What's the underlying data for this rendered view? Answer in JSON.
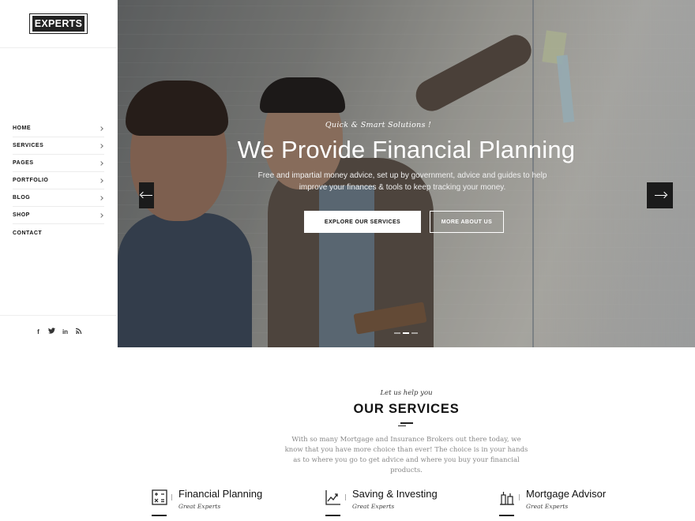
{
  "brand": {
    "logo_text": "EXPERTS"
  },
  "sidebar": {
    "nav": [
      {
        "label": "HOME",
        "has_submenu": true
      },
      {
        "label": "SERVICES",
        "has_submenu": true
      },
      {
        "label": "PAGES",
        "has_submenu": true
      },
      {
        "label": "PORTFOLIO",
        "has_submenu": true
      },
      {
        "label": "BLOG",
        "has_submenu": true
      },
      {
        "label": "SHOP",
        "has_submenu": true
      },
      {
        "label": "CONTACT",
        "has_submenu": false
      }
    ],
    "social": [
      {
        "icon": "facebook-icon",
        "glyph": "f"
      },
      {
        "icon": "twitter-icon",
        "glyph": "t"
      },
      {
        "icon": "linkedin-icon",
        "glyph": "in"
      },
      {
        "icon": "rss-icon",
        "glyph": "≋"
      }
    ]
  },
  "hero": {
    "tagline": "Quick & Smart Solutions !",
    "headline": "We Provide Financial Planning",
    "subtitle": "Free and impartial money advice, set up by government, advice and guides to help improve your finances & tools to keep tracking your money.",
    "primary_button": "EXPLORE OUR SERVICES",
    "secondary_button": "MORE ABOUT US",
    "slide_count": 3,
    "active_slide": 2
  },
  "services": {
    "kicker": "Let us help you",
    "title": "OUR SERVICES",
    "intro": "With so many Mortgage and Insurance Brokers out there today, we know that you have more choice than ever! The choice is in your hands as to where you go to get advice and where you buy your financial products.",
    "items": [
      {
        "name": "Financial Planning",
        "meta": "Great Experts",
        "icon": "calculator-icon"
      },
      {
        "name": "Saving & Investing",
        "meta": "Great Experts",
        "icon": "chart-icon"
      },
      {
        "name": "Mortgage Advisor",
        "meta": "Great Experts",
        "icon": "building-icon"
      }
    ]
  },
  "colors": {
    "dark": "#1b1b1b",
    "text": "#111111",
    "muted": "#888888",
    "white": "#ffffff"
  }
}
